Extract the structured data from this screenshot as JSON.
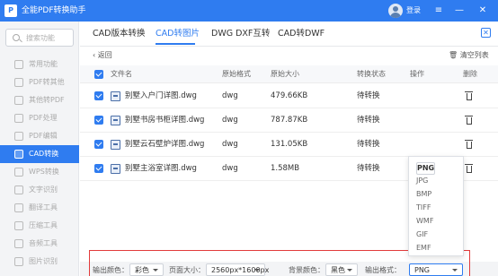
{
  "app": {
    "title": "全能PDF转换助手",
    "logo_text": "P",
    "login": "登录",
    "window_controls": [
      "≡",
      "—",
      "✕"
    ]
  },
  "sidebar": {
    "search_placeholder": "搜索功能",
    "items": [
      {
        "label": "常用功能"
      },
      {
        "label": "PDF转其他"
      },
      {
        "label": "其他转PDF"
      },
      {
        "label": "PDF处理"
      },
      {
        "label": "PDF编辑"
      },
      {
        "label": "CAD转换",
        "active": true
      },
      {
        "label": "WPS转换"
      },
      {
        "label": "文字识别"
      },
      {
        "label": "翻译工具"
      },
      {
        "label": "压缩工具"
      },
      {
        "label": "音频工具"
      },
      {
        "label": "图片识别"
      }
    ]
  },
  "tabs": [
    {
      "label": "CAD版本转换"
    },
    {
      "label": "CAD转图片",
      "active": true
    },
    {
      "label": "DWG DXF互转"
    },
    {
      "label": "CAD转DWF"
    }
  ],
  "toolbar": {
    "back": "返回",
    "clear": "清空列表",
    "close_icon": "✕"
  },
  "table": {
    "headers": [
      "文件名",
      "原始格式",
      "原始大小",
      "转换状态",
      "操作",
      "删除"
    ],
    "rows": [
      {
        "name": "别墅入户门详图.dwg",
        "format": "dwg",
        "size": "479.66KB",
        "status": "待转换"
      },
      {
        "name": "别墅书房书柜详图.dwg",
        "format": "dwg",
        "size": "787.87KB",
        "status": "待转换"
      },
      {
        "name": "别墅云石壁炉详图.dwg",
        "format": "dwg",
        "size": "131.05KB",
        "status": "待转换"
      },
      {
        "name": "别墅主浴室详图.dwg",
        "format": "dwg",
        "size": "1.58MB",
        "status": "待转换"
      }
    ]
  },
  "format_dropdown": {
    "options": [
      "PNG",
      "JPG",
      "BMP",
      "TIFF",
      "WMF",
      "GIF",
      "EMF"
    ],
    "selected": "PNG"
  },
  "output": {
    "color_label": "输出颜色：",
    "color_value": "彩色",
    "page_size_label": "页面大小：",
    "page_size_value": "2560px*1600px",
    "bg_label": "背景颜色：",
    "bg_value": "黑色",
    "format_label": "输出格式：",
    "format_value": "PNG"
  },
  "colors": {
    "accent": "#2f7cf0",
    "highlight_box": "#e23b3b"
  }
}
